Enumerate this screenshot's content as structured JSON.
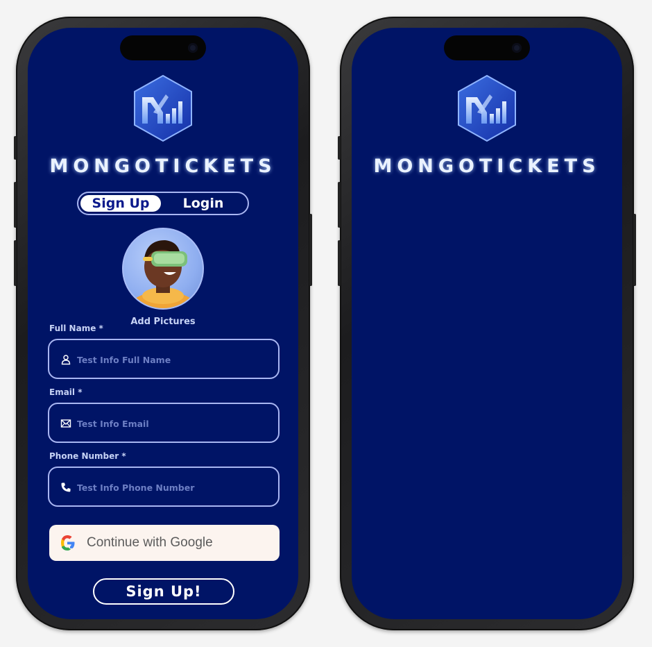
{
  "brand": {
    "name": "MONGOTICKETS"
  },
  "auth_toggle": {
    "signup_label": "Sign Up",
    "login_label": "Login"
  },
  "avatar": {
    "caption": "Add Pictures"
  },
  "form": {
    "full_name": {
      "label": "Full Name *",
      "placeholder": "Test Info Full Name",
      "icon": "user-icon"
    },
    "email": {
      "label": "Email *",
      "placeholder": "Test Info Email",
      "icon": "envelope-icon"
    },
    "phone": {
      "label": "Phone Number *",
      "placeholder": "Test Info Phone Number",
      "icon": "phone-icon"
    }
  },
  "google_button": {
    "label": "Continue with Google",
    "icon": "google-icon"
  },
  "submit_button": {
    "label": "Sign Up!"
  },
  "right_screen": {
    "brand": "MONGOTICKETS"
  },
  "colors": {
    "screen_bg": "#001466",
    "accent_border": "#a9b6f2",
    "google_bg": "#fcf4ef",
    "toggle_active_text": "#0c1a8c"
  }
}
